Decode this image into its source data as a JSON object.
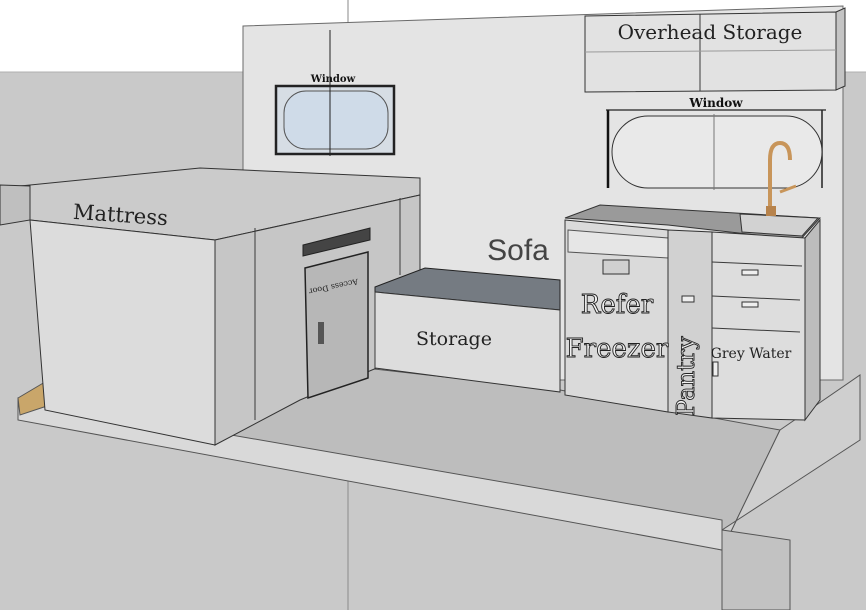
{
  "labels": {
    "overhead_storage": "Overhead Storage",
    "window_left": "Window",
    "window_right": "Window",
    "mattress": "Mattress",
    "sofa": "Sofa",
    "storage": "Storage",
    "refer": "Refer",
    "freezer": "Freezer",
    "pantry": "Pantry",
    "grey_water": "Grey Water",
    "access_door": "Access Door"
  },
  "colors": {
    "background": "#ffffff",
    "wall": "#e2e2e2",
    "ground_plane": "#c8c8c8",
    "floor": "#bdbdbd",
    "cabinet_front": "#d8d8d8",
    "cabinet_side": "#b8b8b8",
    "counter_top": "#9a9a9a",
    "sofa_top": "#777d84",
    "window_glass": "#cfdbe8",
    "faucet": "#c8955a"
  }
}
